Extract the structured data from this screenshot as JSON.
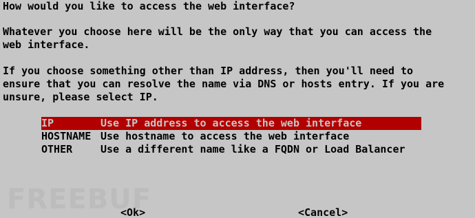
{
  "prompt": {
    "title": "How would you like to access the web interface?",
    "para1": [
      "Whatever you choose here will be the only way that you can access the",
      "web interface."
    ],
    "para2": [
      "If you choose something other than IP address, then you'll need to",
      "ensure that you can resolve the name via DNS or hosts entry. If you are",
      "unsure, please select IP."
    ]
  },
  "menu": {
    "selected_index": 0,
    "items": [
      {
        "tag": "IP",
        "description": "Use IP address to access the web interface"
      },
      {
        "tag": "HOSTNAME",
        "description": "Use hostname to access the web interface"
      },
      {
        "tag": "OTHER",
        "description": "Use a different name like a FQDN or Load Balancer"
      }
    ]
  },
  "buttons": {
    "ok": "<Ok>",
    "cancel": "<Cancel>"
  },
  "watermark": "FREEBUF",
  "colors": {
    "background": "#c6c6c6",
    "highlight": "#b20000",
    "text": "#000000"
  }
}
